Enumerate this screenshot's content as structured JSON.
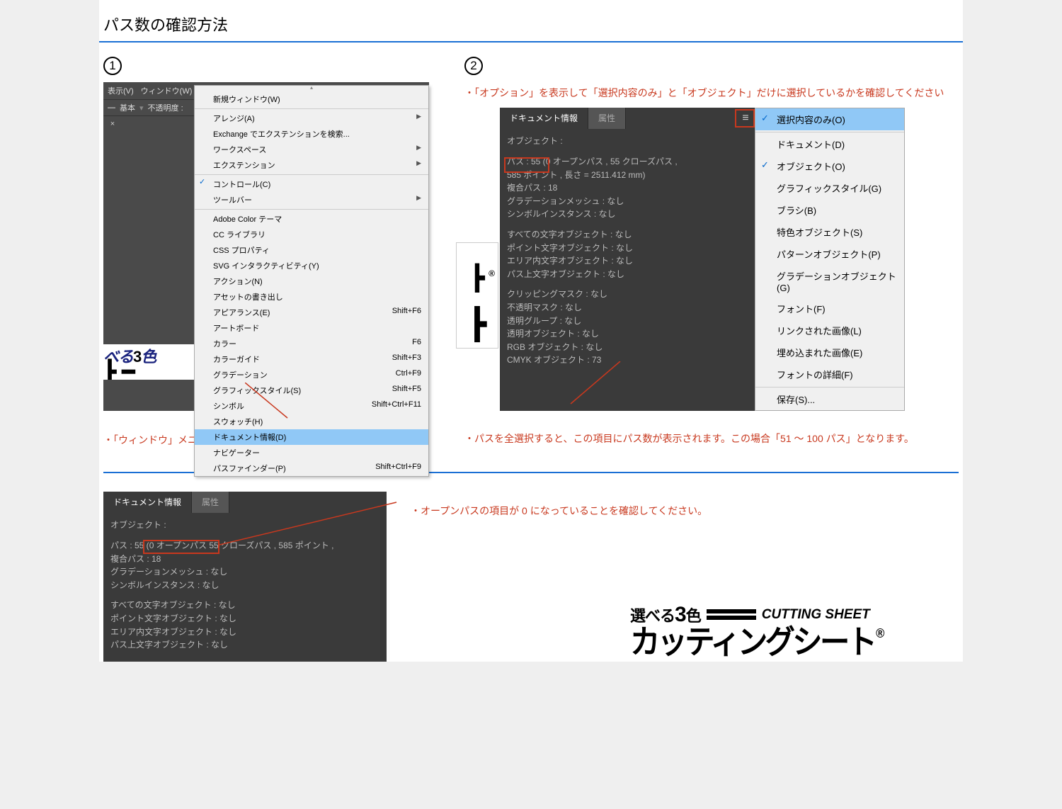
{
  "title": "パス数の確認方法",
  "steps": {
    "one": "1",
    "two": "2"
  },
  "notes": {
    "step1": "・「ウィンドウ」メニューの「ドキュメント情報」を開きます。",
    "step2a": "・「オプション」を表示して「選択内容のみ」と「オブジェクト」だけに選択しているかを確認してください",
    "step2b": "・パスを全選択すると、この項目にパス数が表示されます。この場合「51 ～ 100 パス」となります。",
    "step3": "・オープンパスの項目が 0 になっていることを確認してください。"
  },
  "menubar": {
    "view": "表示(V)",
    "window": "ウィンドウ(W)",
    "basic": "基本",
    "opacity": "不透明度 :"
  },
  "windowMenu": [
    {
      "label": "新規ウィンドウ(W)"
    },
    {
      "label": "アレンジ(A)",
      "sub": true,
      "sep": true
    },
    {
      "label": "Exchange でエクステンションを検索..."
    },
    {
      "label": "ワークスペース",
      "sub": true
    },
    {
      "label": "エクステンション",
      "sub": true
    },
    {
      "label": "コントロール(C)",
      "checked": true,
      "sep": true
    },
    {
      "label": "ツールバー",
      "sub": true
    },
    {
      "label": "Adobe Color テーマ",
      "sep": true
    },
    {
      "label": "CC ライブラリ"
    },
    {
      "label": "CSS プロパティ"
    },
    {
      "label": "SVG インタラクティビティ(Y)"
    },
    {
      "label": "アクション(N)"
    },
    {
      "label": "アセットの書き出し"
    },
    {
      "label": "アピアランス(E)",
      "shortcut": "Shift+F6"
    },
    {
      "label": "アートボード"
    },
    {
      "label": "カラー",
      "shortcut": "F6"
    },
    {
      "label": "カラーガイド",
      "shortcut": "Shift+F3"
    },
    {
      "label": "グラデーション",
      "shortcut": "Ctrl+F9"
    },
    {
      "label": "グラフィックスタイル(S)",
      "shortcut": "Shift+F5"
    },
    {
      "label": "シンボル",
      "shortcut": "Shift+Ctrl+F11"
    },
    {
      "label": "スウォッチ(H)"
    },
    {
      "label": "ドキュメント情報(D)",
      "hl": true
    },
    {
      "label": "ナビゲーター"
    },
    {
      "label": "パスファインダー(P)",
      "shortcut": "Shift+Ctrl+F9"
    }
  ],
  "artText": {
    "a": "べる",
    "b": "3",
    "c": "色"
  },
  "docinfo": {
    "tab1": "ドキュメント情報",
    "tab2": "属性",
    "heading": "オブジェクト :",
    "l1a": "パス : 55 (",
    "l1b": "0 オープンパス , 55 クローズパス ,",
    "l1c": "585 ポイント , 長さ = 2511.412 mm)",
    "l2": "複合パス : 18",
    "l3": "グラデーションメッシュ : なし",
    "l4": "シンボルインスタンス : なし",
    "b1": "すべての文字オブジェクト : なし",
    "b2": "ポイント文字オブジェクト : なし",
    "b3": "エリア内文字オブジェクト : なし",
    "b4": "パス上文字オブジェクト : なし",
    "c1": "クリッピングマスク : なし",
    "c2": "不透明マスク : なし",
    "c3": "透明グループ : なし",
    "c4": "透明オブジェクト : なし",
    "c5": "RGB オブジェクト : なし",
    "c6": "CMYK オブジェクト : 73"
  },
  "flyout": [
    {
      "label": "選択内容のみ(O)",
      "checked": true,
      "hl": true
    },
    {
      "label": "ドキュメント(D)",
      "sep": true
    },
    {
      "label": "オブジェクト(O)",
      "checked": true
    },
    {
      "label": "グラフィックスタイル(G)"
    },
    {
      "label": "ブラシ(B)"
    },
    {
      "label": "特色オブジェクト(S)"
    },
    {
      "label": "パターンオブジェクト(P)"
    },
    {
      "label": "グラデーションオブジェクト(G)"
    },
    {
      "label": "フォント(F)"
    },
    {
      "label": "リンクされた画像(L)"
    },
    {
      "label": "埋め込まれた画像(E)"
    },
    {
      "label": "フォントの詳細(F)"
    },
    {
      "label": "保存(S)...",
      "sep": true
    }
  ],
  "docinfo3": {
    "l1a": "パス : 55 (",
    "l1b": "0 オープンパス",
    "l1c": " 55 クローズパス , 585 ポイント ,"
  },
  "logo": {
    "top1": "選べる",
    "top2": "3",
    "top3": "色",
    "cs": "CUTTING SHEET",
    "main": "カッティングシート",
    "r": "®"
  }
}
